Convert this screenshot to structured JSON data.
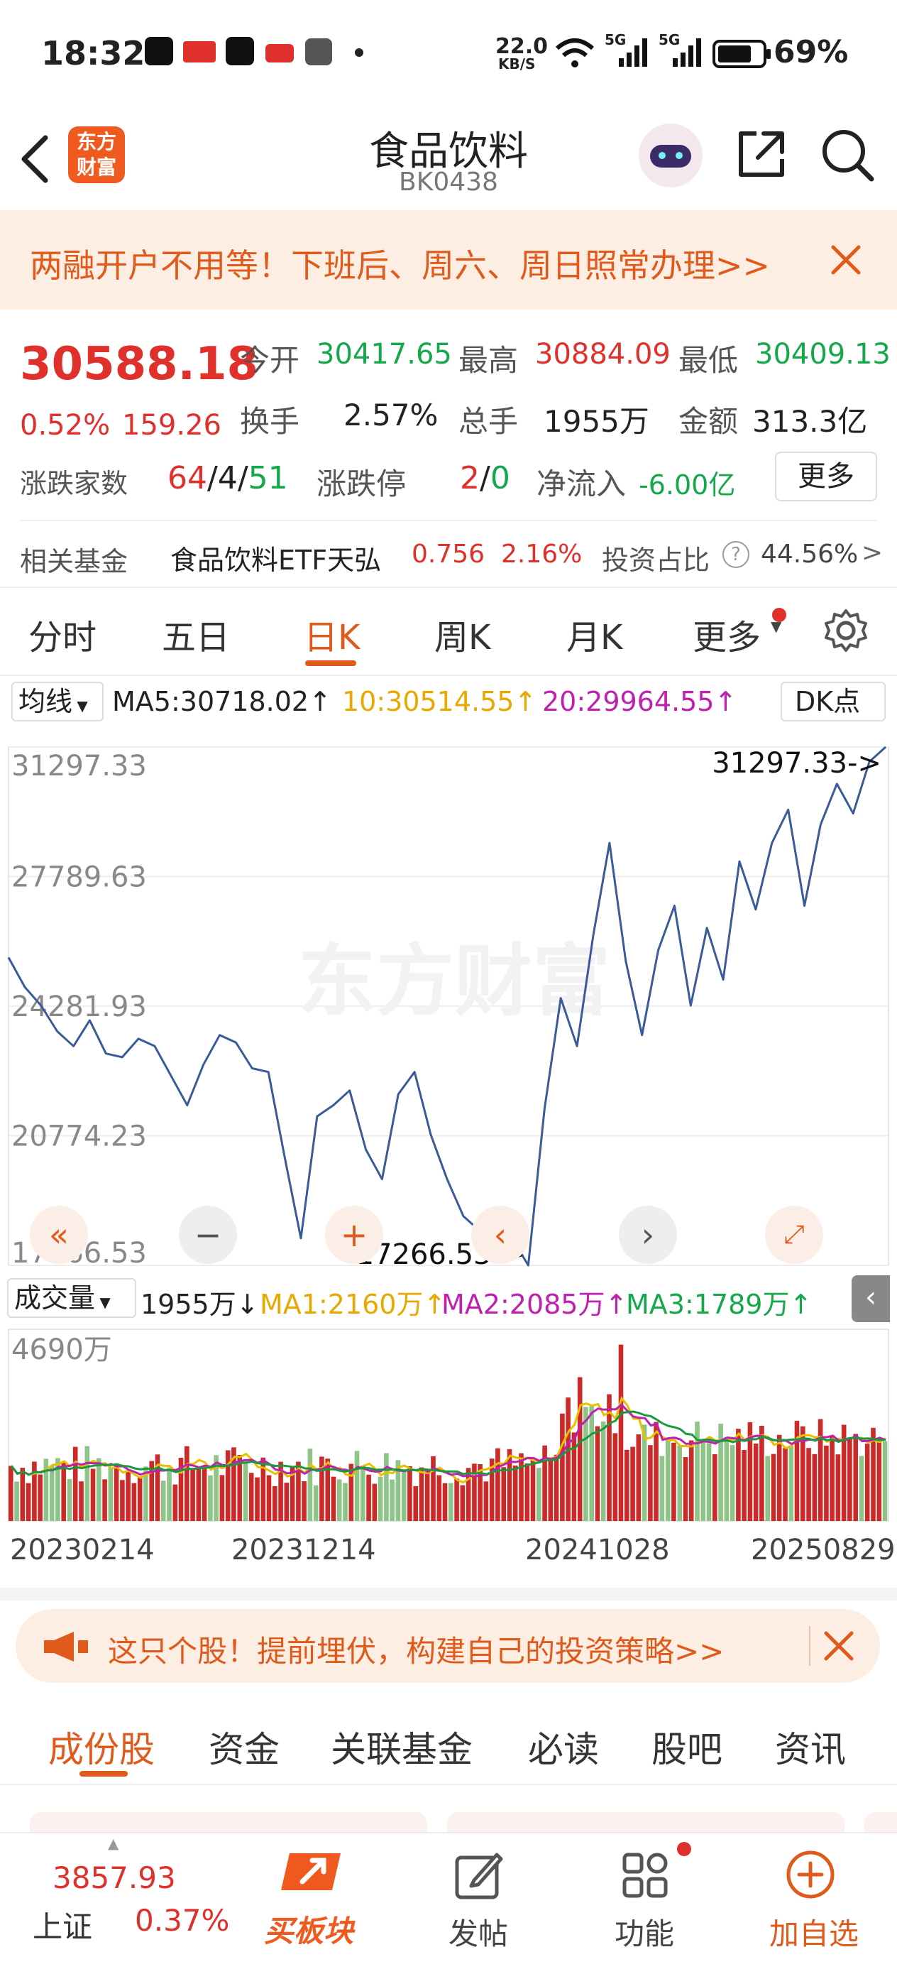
{
  "status": {
    "time": "18:32",
    "app_icons": [
      "tiktok-icon",
      "toutiao-icon",
      "v-icon",
      "youtube-icon",
      "app-icon",
      "dot-icon"
    ],
    "net_speed": "22.0",
    "net_unit": "KB/S",
    "battery": "69%",
    "signal1": "5G",
    "signal2": "5G"
  },
  "header": {
    "logo_line1": "东方",
    "logo_line2": "财富",
    "title": "食品饮料",
    "code": "BK0438"
  },
  "banner": {
    "text": "两融开户不用等！下班后、周六、周日照常办理>>"
  },
  "quote": {
    "price": "30588.18",
    "change_pct": "0.52%",
    "change_abs": "159.26",
    "open_label": "今开",
    "open": "30417.65",
    "high_label": "最高",
    "high": "30884.09",
    "low_label": "最低",
    "low": "30409.13",
    "turnover_label": "换手",
    "turnover": "2.57%",
    "volume_label": "总手",
    "volume": "1955万",
    "amount_label": "金额",
    "amount": "313.3亿",
    "breadth_label": "涨跌家数",
    "breadth_up": "64",
    "breadth_sep1": "/",
    "breadth_flat": "4",
    "breadth_sep2": "/",
    "breadth_down": "51",
    "limit_label": "涨跌停",
    "limit_up": "2",
    "limit_sep": "/",
    "limit_down": "0",
    "netflow_label": "净流入",
    "netflow": "-6.00亿",
    "more_button": "更多"
  },
  "fund": {
    "label": "相关基金",
    "name": "食品饮料ETF天弘",
    "price": "0.756",
    "pct": "2.16%",
    "ratio_label": "投资占比",
    "ratio": "44.56%",
    "arrow": ">"
  },
  "ktabs": [
    "分时",
    "五日",
    "日K",
    "周K",
    "月K",
    "更多"
  ],
  "active_tab": 2,
  "ma_bar": {
    "select": "均线",
    "ma5": "MA5:30718.02↑",
    "ma10": "10:30514.55↑",
    "ma20": "20:29964.55↑",
    "dk": "DK点"
  },
  "price_axis": [
    "31297.33",
    "27789.63",
    "24281.93",
    "20774.23",
    "17266.53"
  ],
  "max_label": "31297.33->",
  "min_label": "17266.53->",
  "watermark": "东方财富",
  "vol_bar": {
    "select": "成交量",
    "current": "1955万↓",
    "ma1": "MA1:2160万↑",
    "ma2": "MA2:2085万↑",
    "ma3": "MA3:1789万↑",
    "max": "4690万"
  },
  "date_axis": [
    "20230214",
    "20231214",
    "20241028",
    "20250829"
  ],
  "ad": {
    "text": "这只个股！提前埋伏，构建自己的投资策略>>"
  },
  "sections": [
    "成份股",
    "资金",
    "关联基金",
    "必读",
    "股吧",
    "资讯"
  ],
  "bottom": {
    "index_value": "3857.93",
    "index_name": "上证",
    "index_pct": "0.37%",
    "buy_label": "买板块",
    "post_label": "发帖",
    "func_label": "功能",
    "add_label": "加自选"
  },
  "colors": {
    "up": "#e0302c",
    "down": "#14a84a",
    "accent": "#e05a1c",
    "ma5": "#222222",
    "ma10": "#e8a800",
    "ma20": "#c020b0",
    "line": "#3a5a9a"
  },
  "chart_data": {
    "type": "line",
    "title": "",
    "ylim": [
      17266.53,
      31297.33
    ],
    "x": [
      "20230214",
      "20231214",
      "20241028",
      "20250829"
    ],
    "series": [
      {
        "values": [
          25600,
          24800,
          24300,
          23600,
          23200,
          23900,
          23000,
          22900,
          23400,
          23200,
          22400,
          21600,
          22700,
          23500,
          23300,
          22600,
          22500,
          20200,
          18000,
          21300,
          21600,
          22000,
          20400,
          19600,
          21900,
          22500,
          20800,
          19600,
          18600,
          18200,
          17700,
          18000,
          17266.53,
          21500,
          24500,
          23200,
          26200,
          28700,
          25500,
          23500,
          25800,
          27000,
          24300,
          26400,
          25000,
          28200,
          26900,
          28700,
          29600,
          27000,
          29200,
          30300,
          29500,
          30900,
          31297.33
        ]
      }
    ]
  }
}
